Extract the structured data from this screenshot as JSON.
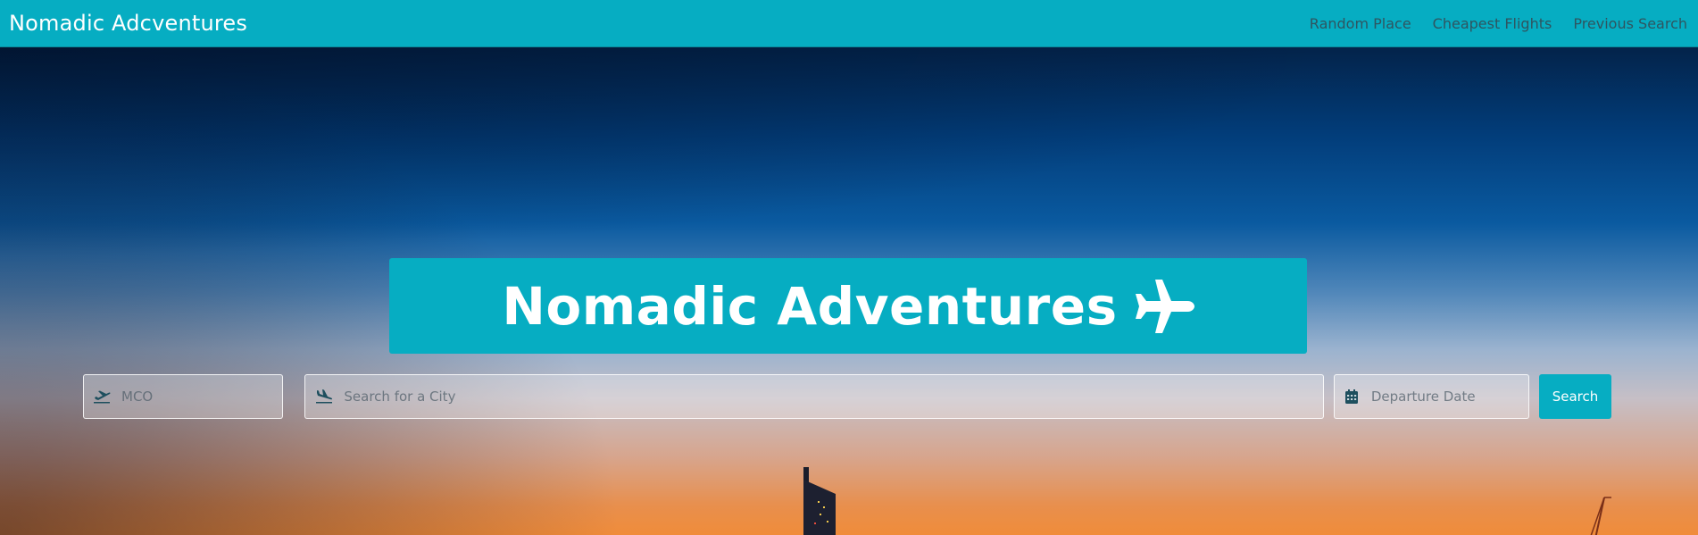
{
  "navbar": {
    "brand": "Nomadic Adcventures",
    "links": [
      "Random Place",
      "Cheapest Flights",
      "Previous Search"
    ]
  },
  "banner": {
    "title": "Nomadic Adventures",
    "icon": "plane-icon"
  },
  "search": {
    "origin_placeholder": "MCO",
    "destination_placeholder": "Search for a City",
    "date_placeholder": "Departure Date",
    "button_label": "Search",
    "origin_icon": "plane-departure-icon",
    "destination_icon": "plane-arrival-icon",
    "date_icon": "calendar-icon"
  },
  "colors": {
    "accent": "#06adc2",
    "sky_top": "#03234a",
    "sunset": "#f08c3a",
    "nav_link": "#2f5560"
  }
}
